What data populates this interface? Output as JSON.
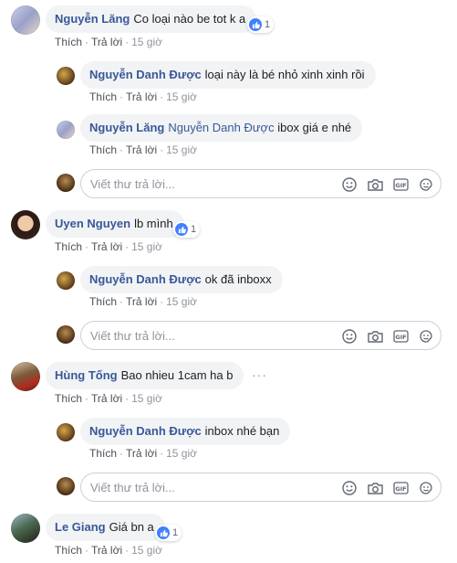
{
  "actions": {
    "like": "Thích",
    "reply": "Trả lời",
    "sep": "·"
  },
  "reply_placeholder": "Viết thư trả lời...",
  "comments": [
    {
      "author": "Nguyễn Lăng",
      "text": "Co loại nào be tot k a",
      "reactions": "1",
      "time": "15 giờ",
      "replies": [
        {
          "author": "Nguyễn Danh Được",
          "text": "loại này là bé nhỏ xinh xinh rồi",
          "time": "15 giờ"
        },
        {
          "author": "Nguyễn Lăng",
          "tag": "Nguyễn Danh Được",
          "text": "ibox giá e nhé",
          "time": "15 giờ"
        }
      ]
    },
    {
      "author": "Uyen Nguyen",
      "text": "lb mình",
      "reactions": "1",
      "time": "15 giờ",
      "replies": [
        {
          "author": "Nguyễn Danh Được",
          "text": "ok đã inboxx",
          "time": "15 giờ"
        }
      ]
    },
    {
      "author": "Hùng Tống",
      "text": "Bao nhieu 1cam ha b",
      "time": "15 giờ",
      "replies": [
        {
          "author": "Nguyễn Danh Được",
          "text": "inbox nhé bạn",
          "time": "15 giờ"
        }
      ]
    },
    {
      "author": "Le Giang",
      "text": "Giá bn a",
      "reactions": "1",
      "time": "15 giờ"
    }
  ],
  "colors": {
    "name": "#385898",
    "bubble": "#f2f3f5",
    "like_badge": "#4080ff",
    "meta": "#606770"
  }
}
